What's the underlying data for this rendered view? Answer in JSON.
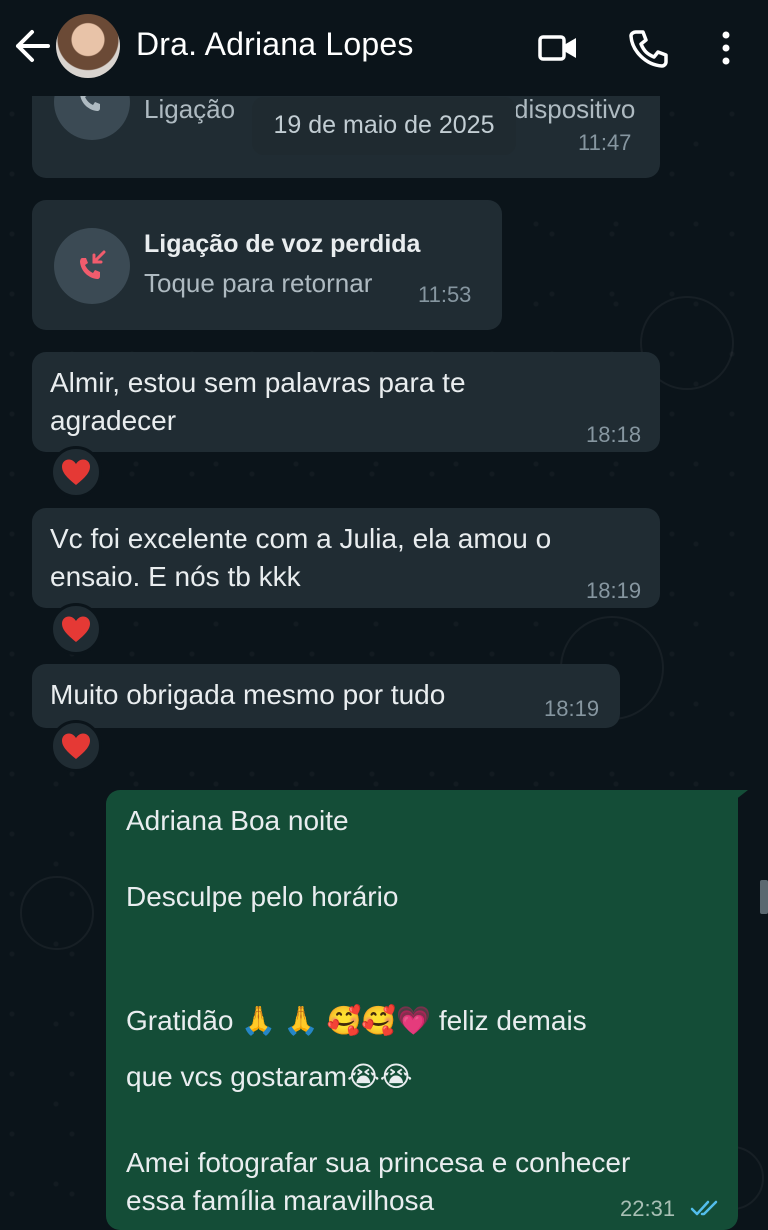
{
  "header": {
    "contact_name": "Dra. Adriana Lopes"
  },
  "date_chip": "19 de maio de 2025",
  "messages": [
    {
      "kind": "call",
      "title": "Ligação",
      "title_tail": "dispositivo",
      "time": "11:47"
    },
    {
      "kind": "missed_call",
      "title": "Ligação de voz perdida",
      "subtitle": "Toque para retornar",
      "time": "11:53"
    },
    {
      "kind": "in",
      "text_lines": [
        "Almir, estou sem palavras para te",
        "agradecer"
      ],
      "time": "18:18",
      "reaction": "❤"
    },
    {
      "kind": "in",
      "text_lines": [
        "Vc foi excelente com a Julia, ela amou o",
        "ensaio. E nós tb kkk"
      ],
      "time": "18:19",
      "reaction": "❤"
    },
    {
      "kind": "in",
      "text_lines": [
        "Muito obrigada mesmo por tudo"
      ],
      "time": "18:19",
      "reaction": "❤"
    },
    {
      "kind": "out",
      "line1": "Adriana Boa noite",
      "line2": "Desculpe pelo horário",
      "line3": "Gratidão 🙏 🙏 🥰🥰💗 feliz demais",
      "line4": "que vcs gostaram😭😭",
      "line5": "Amei fotografar sua princesa e conhecer",
      "line6": "essa família maravilhosa",
      "time": "22:31"
    }
  ],
  "colors": {
    "background": "#0b141a",
    "incoming_bubble": "#202c33",
    "outgoing_bubble": "#144d37",
    "missed_call_red": "#f15c6d",
    "read_tick_blue": "#53bdeb"
  },
  "icons": [
    "back-arrow-icon",
    "video-call-icon",
    "phone-icon",
    "more-vert-icon",
    "missed-call-icon",
    "heart-icon",
    "double-check-icon"
  ]
}
